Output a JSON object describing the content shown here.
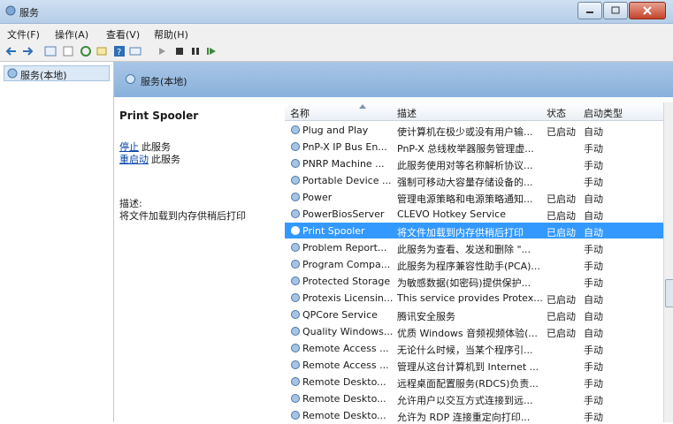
{
  "window": {
    "title": "服务"
  },
  "menu": [
    "文件(F)",
    "操作(A)",
    "查看(V)",
    "帮助(H)"
  ],
  "tree": {
    "item": "服务(本地)"
  },
  "header": {
    "label": "服务(本地)"
  },
  "desc": {
    "title": "Print Spooler",
    "stop_link": "停止",
    "stop_rest": "此服务",
    "restart_link": "重启动",
    "restart_rest": "此服务",
    "desc_label": "描述:",
    "desc_text": "将文件加载到内存供稍后打印"
  },
  "columns": {
    "name": "名称",
    "desc": "描述",
    "status": "状态",
    "startup": "启动类型"
  },
  "rows": [
    {
      "name": "Plug and Play",
      "desc": "使计算机在极少或没有用户输...",
      "status": "已启动",
      "startup": "自动"
    },
    {
      "name": "PnP-X IP Bus En...",
      "desc": "PnP-X 总线枚举器服务管理虚...",
      "status": "",
      "startup": "手动"
    },
    {
      "name": "PNRP Machine ...",
      "desc": "此服务使用对等名称解析协议...",
      "status": "",
      "startup": "手动"
    },
    {
      "name": "Portable Device ...",
      "desc": "强制可移动大容量存储设备的...",
      "status": "",
      "startup": "手动"
    },
    {
      "name": "Power",
      "desc": "管理电源策略和电源策略通知...",
      "status": "已启动",
      "startup": "自动"
    },
    {
      "name": "PowerBiosServer",
      "desc": "CLEVO Hotkey Service",
      "status": "已启动",
      "startup": "自动"
    },
    {
      "name": "Print Spooler",
      "desc": "将文件加载到内存供稍后打印",
      "status": "已启动",
      "startup": "自动",
      "selected": true
    },
    {
      "name": "Problem Report...",
      "desc": "此服务为查看、发送和删除 \"...",
      "status": "",
      "startup": "手动"
    },
    {
      "name": "Program Compa...",
      "desc": "此服务为程序兼容性助手(PCA)...",
      "status": "",
      "startup": "手动"
    },
    {
      "name": "Protected Storage",
      "desc": "为敏感数据(如密码)提供保护...",
      "status": "",
      "startup": "手动"
    },
    {
      "name": "Protexis Licensin...",
      "desc": "This service provides Protex...",
      "status": "已启动",
      "startup": "自动"
    },
    {
      "name": "QPCore Service",
      "desc": "腾讯安全服务",
      "status": "已启动",
      "startup": "自动"
    },
    {
      "name": "Quality Windows...",
      "desc": "优质 Windows 音频视频体验(...",
      "status": "已启动",
      "startup": "自动"
    },
    {
      "name": "Remote Access ...",
      "desc": "无论什么时候，当某个程序引...",
      "status": "",
      "startup": "手动"
    },
    {
      "name": "Remote Access ...",
      "desc": "管理从这台计算机到 Internet ...",
      "status": "",
      "startup": "手动"
    },
    {
      "name": "Remote Deskto...",
      "desc": "远程桌面配置服务(RDCS)负责...",
      "status": "",
      "startup": "手动"
    },
    {
      "name": "Remote Deskto...",
      "desc": "允许用户以交互方式连接到远...",
      "status": "",
      "startup": "手动"
    },
    {
      "name": "Remote Deskto...",
      "desc": "允许为 RDP 连接重定向打印...",
      "status": "",
      "startup": "手动"
    }
  ],
  "colors": {
    "selection": "#3399ff",
    "header": "#88b1dc",
    "link": "#0645ad"
  },
  "icons": [
    "gear-icon",
    "back-arrow-icon",
    "forward-arrow-icon",
    "play-icon",
    "stop-icon",
    "pause-icon",
    "resume-icon",
    "help-icon"
  ]
}
